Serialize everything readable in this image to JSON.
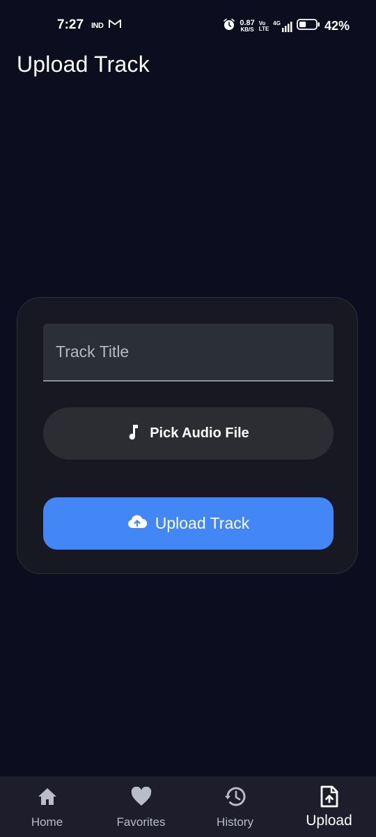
{
  "status_bar": {
    "time": "7:27",
    "carrier": "IND",
    "net_speed": "0.87",
    "net_speed_unit": "KB/S",
    "volte_top": "Vo",
    "volte_bottom": "LTE",
    "network": "4G",
    "battery_percent": "42%",
    "battery_level": 0.42,
    "icons": [
      "gmail-icon",
      "alarm-icon",
      "signal-icon",
      "battery-icon"
    ]
  },
  "header": {
    "title": "Upload Track"
  },
  "form": {
    "title_placeholder": "Track Title",
    "title_value": "",
    "pick_label": "Pick Audio File",
    "pick_icon": "music-note-icon",
    "upload_label": "Upload Track",
    "upload_icon": "cloud-upload-icon"
  },
  "colors": {
    "background": "#0d0d20",
    "card": "#181822",
    "accent": "#4287f5",
    "nav_background": "#1d1d2b"
  },
  "bottom_nav": {
    "active": "Upload",
    "items": [
      {
        "label": "Home",
        "icon": "home-icon"
      },
      {
        "label": "Favorites",
        "icon": "heart-icon"
      },
      {
        "label": "History",
        "icon": "history-icon"
      },
      {
        "label": "Upload",
        "icon": "file-upload-icon"
      }
    ]
  }
}
